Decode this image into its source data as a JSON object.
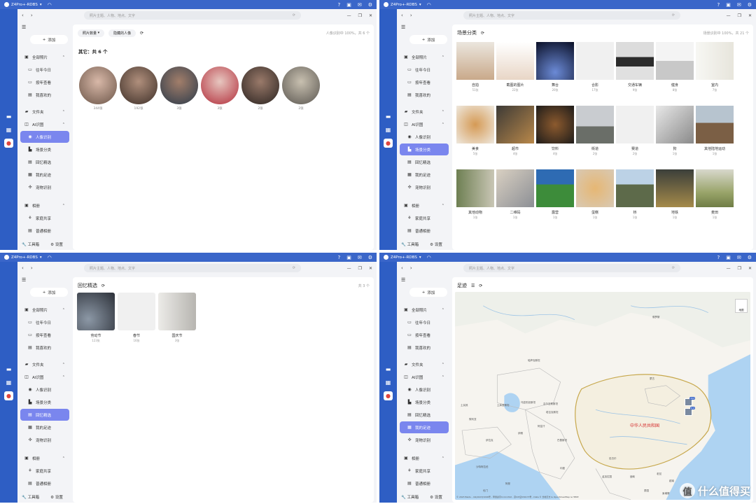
{
  "shared": {
    "device": "Z4Pro+-RDBS",
    "search_placeholder": "照片主题、人物、地点、文字",
    "add": "添加",
    "toolbox": "工具箱",
    "settings": "设置",
    "nav_all_photos": "全部照片",
    "nav_past_today": "往年今日",
    "nav_by_year": "按年查看",
    "nav_favorites": "我喜欢的",
    "nav_folders": "文件夹",
    "nav_ai": "AI识图",
    "nav_people": "人像识别",
    "nav_scenes": "场景分类",
    "nav_memories": "回忆精选",
    "nav_footprints": "我的足迹",
    "nav_pets": "宠物识别",
    "nav_albums": "相册",
    "nav_family": "家庭共享",
    "nav_shared": "普通相册",
    "accent": "#7a86ee"
  },
  "people": {
    "filter_count": "照片数量",
    "filter_hidden": "隐藏的人像",
    "status": "人像识别中 100%，共 6 个",
    "subtitle": "其它：共 6 个",
    "items": [
      {
        "count": "344张"
      },
      {
        "count": "192张"
      },
      {
        "count": "3张"
      },
      {
        "count": "3张"
      },
      {
        "count": "2张"
      },
      {
        "count": "2张"
      }
    ]
  },
  "scenes": {
    "title": "场景分类",
    "status": "场景识别中 100%，共 21 个",
    "items": [
      {
        "name": "自拍",
        "count": "51张"
      },
      {
        "name": "截图的图片",
        "count": "22张"
      },
      {
        "name": "舞台",
        "count": "20张"
      },
      {
        "name": "合影",
        "count": "17张"
      },
      {
        "name": "交通车辆",
        "count": "9张"
      },
      {
        "name": "健身",
        "count": "8张"
      },
      {
        "name": "室内",
        "count": "7张"
      },
      {
        "name": "美食",
        "count": "5张"
      },
      {
        "name": "超市",
        "count": "4张"
      },
      {
        "name": "饮料",
        "count": "4张"
      },
      {
        "name": "街道",
        "count": "2张"
      },
      {
        "name": "赛道",
        "count": "2张"
      },
      {
        "name": "狗",
        "count": "1张"
      },
      {
        "name": "其他陆地运动",
        "count": "1张"
      },
      {
        "name": "其他动物",
        "count": "1张"
      },
      {
        "name": "二维码",
        "count": "1张"
      },
      {
        "name": "露营",
        "count": "1张"
      },
      {
        "name": "蛋糕",
        "count": "1张"
      },
      {
        "name": "桥",
        "count": "1张"
      },
      {
        "name": "地铁",
        "count": "1张"
      },
      {
        "name": "麦田",
        "count": "1张"
      }
    ]
  },
  "memories": {
    "title": "回忆精选",
    "status": "共 3 个",
    "items": [
      {
        "name": "劳动节",
        "count": "123张"
      },
      {
        "name": "春节",
        "count": "16张"
      },
      {
        "name": "国庆节",
        "count": "3张"
      }
    ]
  },
  "footprints": {
    "title": "足迹",
    "map_toggle": "地图",
    "country": "中华人民共和国",
    "pin1": "253",
    "pin2": "8.0",
    "places": [
      "俄罗斯",
      "蒙古",
      "哈萨克斯坦",
      "土库曼斯坦",
      "乌兹别克斯坦",
      "吉尔吉斯斯坦",
      "塔吉克斯坦",
      "阿富汗",
      "伊朗",
      "巴基斯坦",
      "印度",
      "尼泊尔",
      "孟加拉国",
      "缅甸",
      "泰国",
      "老挝",
      "越南",
      "柬埔寨",
      "伊拉克",
      "叙利亚",
      "土耳其",
      "沙特阿拉伯",
      "阿曼",
      "也门"
    ],
    "credit": "© 2023 Baidu - GS(2023)3206号 - 甲测资字11111342 - 京ICP证030173号 - Data © 长地万方 & OpenStreetMap & HERE"
  },
  "watermark": "什么值得买"
}
